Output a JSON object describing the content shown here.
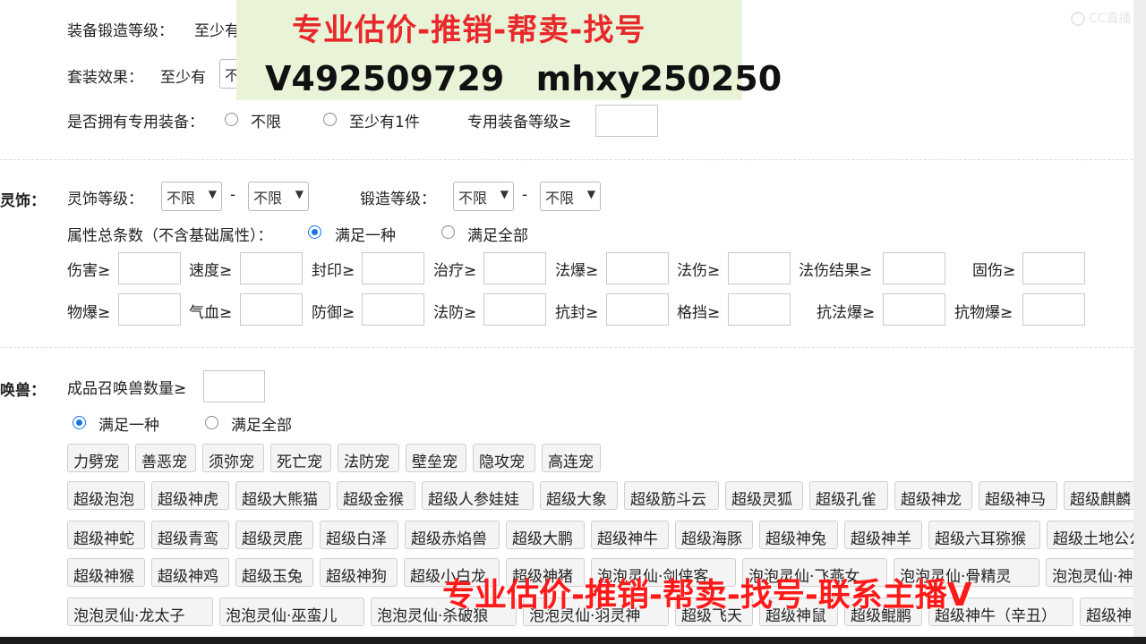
{
  "equipment": {
    "forge_level_label": "装备锻造等级：",
    "forge_level_value": "至少有",
    "set_effect_label": "套装效果：",
    "set_effect_value": "至少有",
    "set_effect_select": "不",
    "exclusive_label": "是否拥有专用装备：",
    "exclusive_opt_any": "不限",
    "exclusive_opt_one": "至少有1件",
    "exclusive_level_label": "专用装备等级≥"
  },
  "banner": {
    "title": "专业估价-推销-帮卖-找号",
    "ids": "V492509729 mhxy250250"
  },
  "lingshi": {
    "section": "灵饰：",
    "level_label": "灵饰等级：",
    "level_from": "不限",
    "level_to": "不限",
    "dash": "-",
    "forge_label": "锻造等级：",
    "forge_from": "不限",
    "forge_to": "不限",
    "attr_label": "属性总条数（不含基础属性）：",
    "opt_one": "满足一种",
    "opt_all": "满足全部",
    "row1": [
      "伤害≥",
      "速度≥",
      "封印≥",
      "治疗≥",
      "法爆≥",
      "法伤≥",
      "法伤结果≥",
      "固伤≥"
    ],
    "row2": [
      "物爆≥",
      "气血≥",
      "防御≥",
      "法防≥",
      "抗封≥",
      "格挡≥",
      "抗法爆≥",
      "抗物爆≥"
    ]
  },
  "pets": {
    "section": "唤兽：",
    "count_label": "成品召唤兽数量≥",
    "opt_one": "满足一种",
    "opt_all": "满足全部",
    "row1": [
      "力劈宠",
      "善恶宠",
      "须弥宠",
      "死亡宠",
      "法防宠",
      "壁垒宠",
      "隐攻宠",
      "高连宠"
    ],
    "row2": [
      "超级泡泡",
      "超级神虎",
      "超级大熊猫",
      "超级金猴",
      "超级人参娃娃",
      "超级大象",
      "超级筋斗云",
      "超级灵狐",
      "超级孔雀",
      "超级神龙",
      "超级神马",
      "超级麒麟"
    ],
    "row3": [
      "超级神蛇",
      "超级青鸾",
      "超级灵鹿",
      "超级白泽",
      "超级赤焰兽",
      "超级大鹏",
      "超级神牛",
      "超级海豚",
      "超级神兔",
      "超级神羊",
      "超级六耳猕猴",
      "超级土地公公"
    ],
    "row4": [
      "超级神猴",
      "超级神鸡",
      "超级玉兔",
      "超级神狗",
      "超级小白龙",
      "超级神猪",
      "泡泡灵仙·剑侠客",
      "泡泡灵仙·飞燕女",
      "泡泡灵仙·骨精灵",
      "泡泡灵仙·神"
    ],
    "row5": [
      "泡泡灵仙·龙太子",
      "泡泡灵仙·巫蛮儿",
      "泡泡灵仙·杀破狼",
      "泡泡灵仙·羽灵神",
      "超级飞天",
      "超级神鼠",
      "超级鲲鹏",
      "超级神牛（辛丑）",
      "超级神"
    ]
  },
  "overlay": {
    "red_text": "专业估价-推销-帮卖-找号-联系主播V"
  },
  "watermark": {
    "text": "CC直播",
    "icon": "cc-logo-icon"
  }
}
